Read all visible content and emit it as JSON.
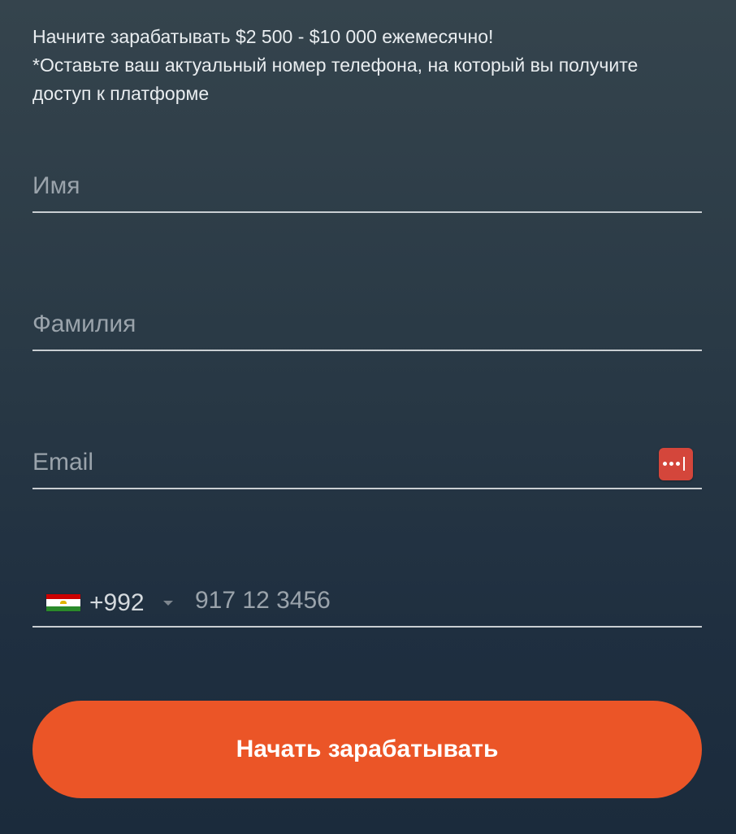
{
  "intro": {
    "line1": "Начните зарабатывать $2 500 - $10 000 ежемесячно!",
    "line2": "*Оставьте ваш актуальный номер телефона, на который вы получите доступ к платформе"
  },
  "form": {
    "first_name": {
      "placeholder": "Имя",
      "value": ""
    },
    "last_name": {
      "placeholder": "Фамилия",
      "value": ""
    },
    "email": {
      "placeholder": "Email",
      "value": "",
      "password_manager_icon": "password-manager-icon"
    },
    "phone": {
      "country_flag": "tajikistan-flag-icon",
      "dial_code": "+992",
      "placeholder": "917 12 3456",
      "value": ""
    },
    "submit_label": "Начать зарабатывать"
  },
  "colors": {
    "accent": "#eb5527",
    "password_icon": "#d4463b",
    "background_top": "#35444d",
    "background_bottom": "#1b2b3c",
    "underline": "#c9ced2"
  }
}
